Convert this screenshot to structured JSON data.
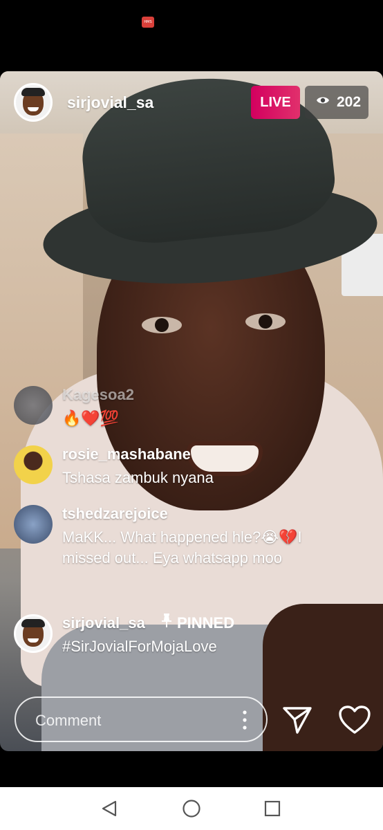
{
  "status_bar": {
    "app_icon_label": "HMS"
  },
  "host": {
    "username": "sirjovial_sa"
  },
  "badges": {
    "live": "LIVE",
    "viewer_count": "202"
  },
  "comments": [
    {
      "user": "Kagesoa2",
      "text": "🔥❤️💯"
    },
    {
      "user": "rosie_mashabane",
      "text": "Tshasa zambuk nyana"
    },
    {
      "user": "tshedzarejoice",
      "text": "MaKK... What happened hle?😭💔I missed out... Eya whatsapp moo"
    },
    {
      "user": "sirjovial_sa",
      "pinned_label": "PINNED",
      "text": "#SirJovialForMojaLove"
    }
  ],
  "composer": {
    "placeholder": "Comment"
  },
  "icons": {
    "viewers": "eye-icon",
    "pin": "pin-icon",
    "more": "more-vertical-icon",
    "send": "send-icon",
    "like": "heart-icon",
    "nav_back": "back-triangle-icon",
    "nav_home": "home-circle-icon",
    "nav_recent": "recent-square-icon"
  },
  "colors": {
    "live_badge": "#e1306c",
    "background": "#000000"
  }
}
